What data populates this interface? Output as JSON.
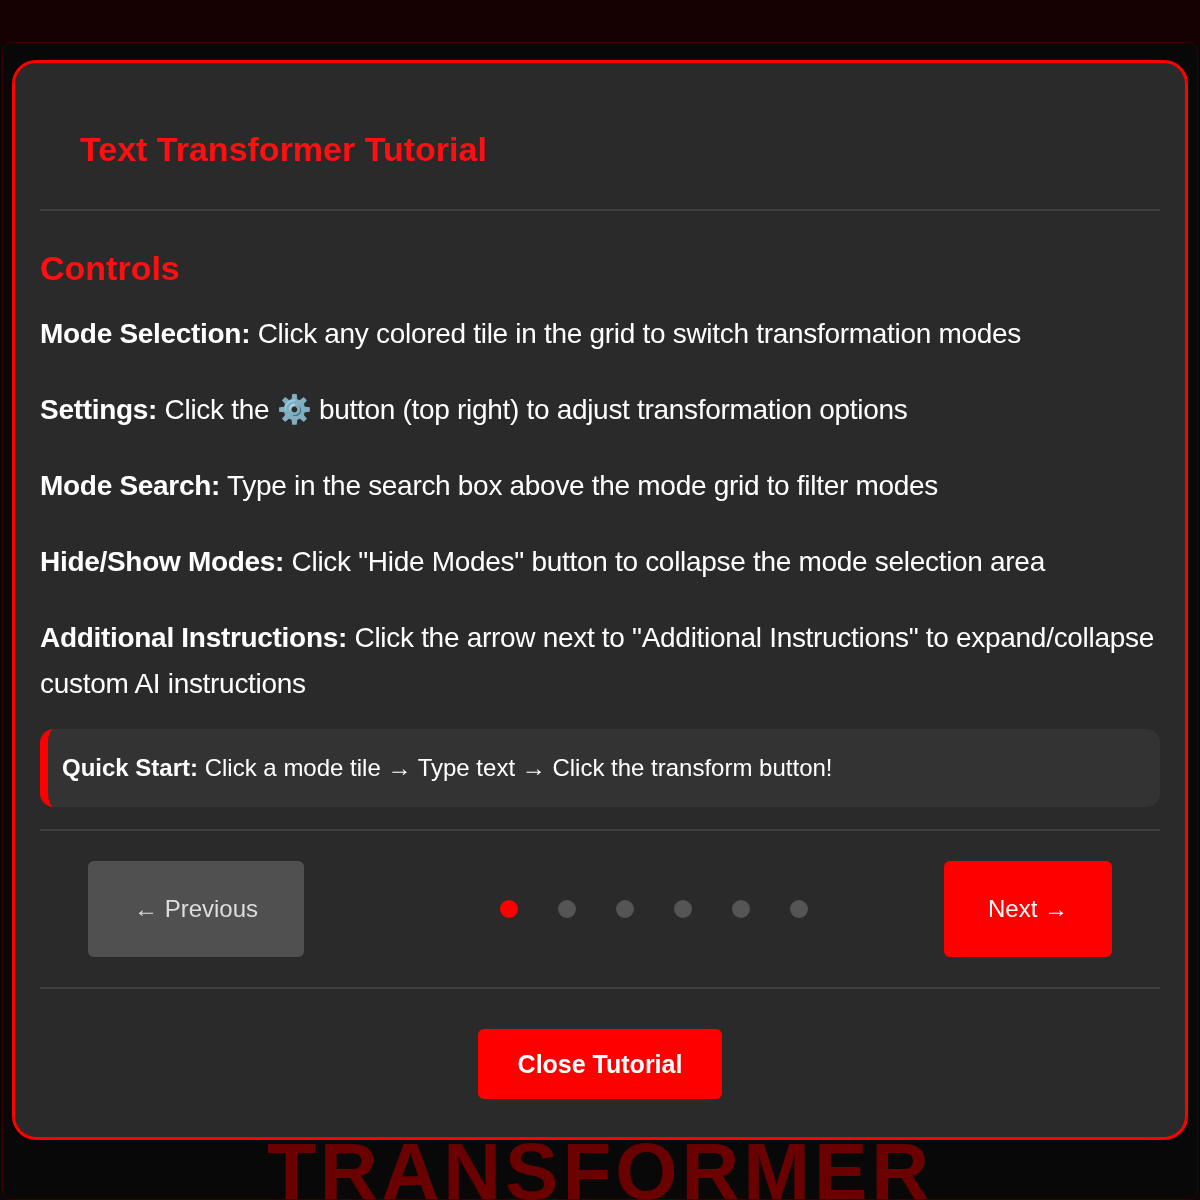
{
  "background": {
    "banner": "TRANSFORMER"
  },
  "modal": {
    "title": "Text Transformer Tutorial",
    "section_heading": "Controls",
    "instructions": [
      {
        "label": "Mode Selection:",
        "text": "Click any colored tile in the grid to switch transformation modes"
      },
      {
        "label": "Settings:",
        "text": "Click the ⚙️ button (top right) to adjust transformation options"
      },
      {
        "label": "Mode Search:",
        "text": "Type in the search box above the mode grid to filter modes"
      },
      {
        "label": "Hide/Show Modes:",
        "text": "Click \"Hide Modes\" button to collapse the mode selection area"
      },
      {
        "label": "Additional Instructions:",
        "text": "Click the arrow next to \"Additional Instructions\" to expand/collapse custom AI instructions"
      }
    ],
    "tip": {
      "label": "Quick Start:",
      "text": "Click a mode tile → Type text → Click the transform button!"
    },
    "previous_button": {
      "label": "← Previous",
      "disabled": true
    },
    "steps": [
      {
        "selected": true
      },
      {
        "selected": false
      },
      {
        "selected": false
      },
      {
        "selected": false
      },
      {
        "selected": false
      },
      {
        "selected": false
      }
    ],
    "next_button": {
      "label": "Next →"
    },
    "close_button": {
      "label": "Close Tutorial"
    }
  }
}
